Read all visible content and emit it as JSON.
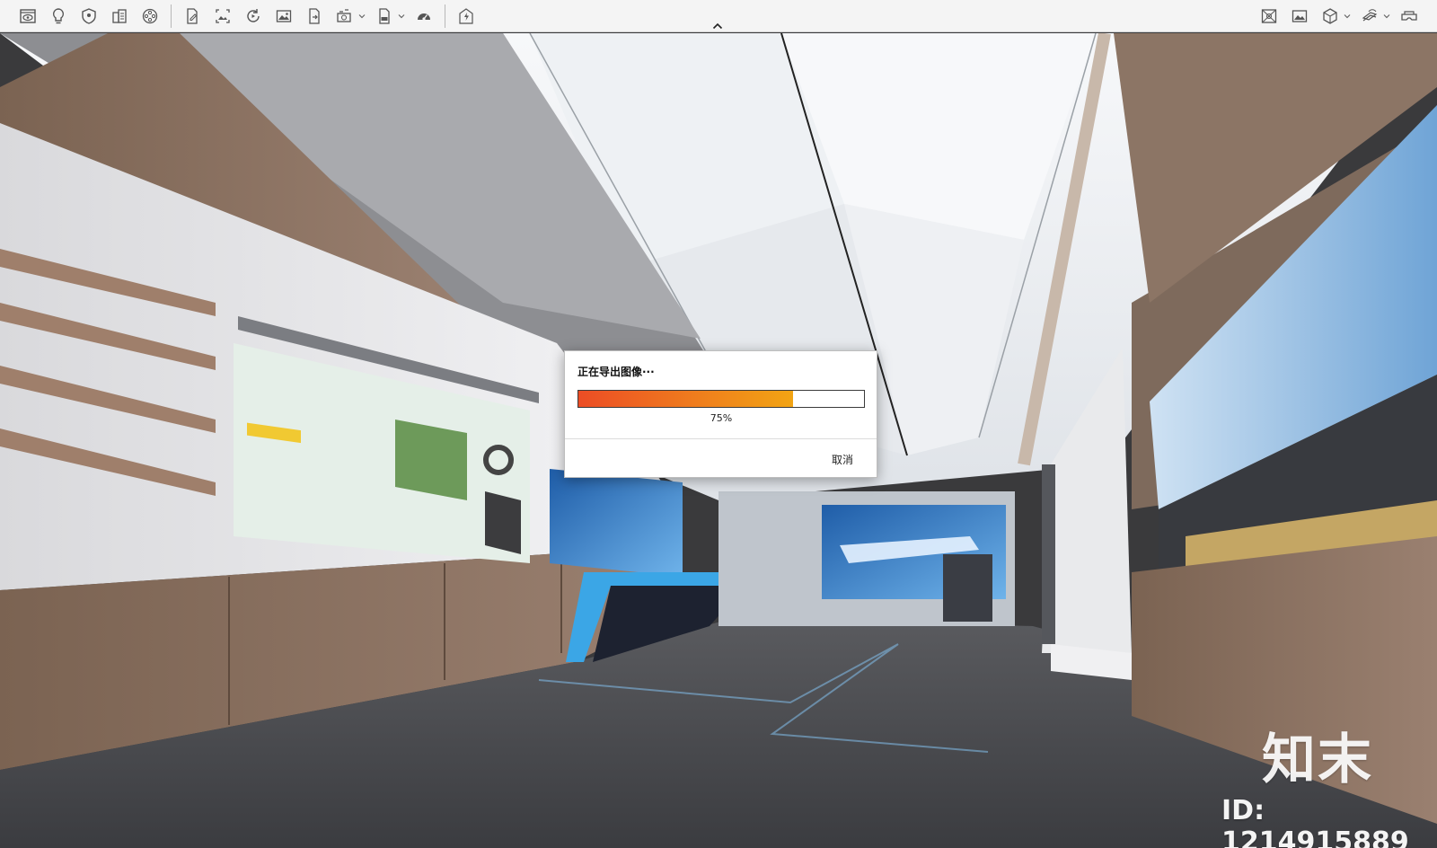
{
  "toolbar": {
    "left_icons": [
      "eye-icon",
      "lightbulb-icon",
      "shield-icon",
      "building-icon",
      "film-reel-icon",
      "edit-document-icon",
      "capture-image-icon",
      "refresh-play-icon",
      "image-icon",
      "export-file-icon",
      "render-camera-icon",
      "exr-file-icon",
      "speedometer-icon",
      "lightning-icon"
    ],
    "right_icons": [
      "panorama-grid-icon",
      "picture-icon",
      "cube-icon",
      "layers-icon",
      "vr-headset-icon"
    ]
  },
  "scene": {
    "watermark_site": "知末",
    "watermark_id": "ID: 1214915889"
  },
  "dialog": {
    "title": "正在导出图像···",
    "progress_value": 0.75,
    "progress_text": "75%",
    "cancel_label": "取消"
  }
}
